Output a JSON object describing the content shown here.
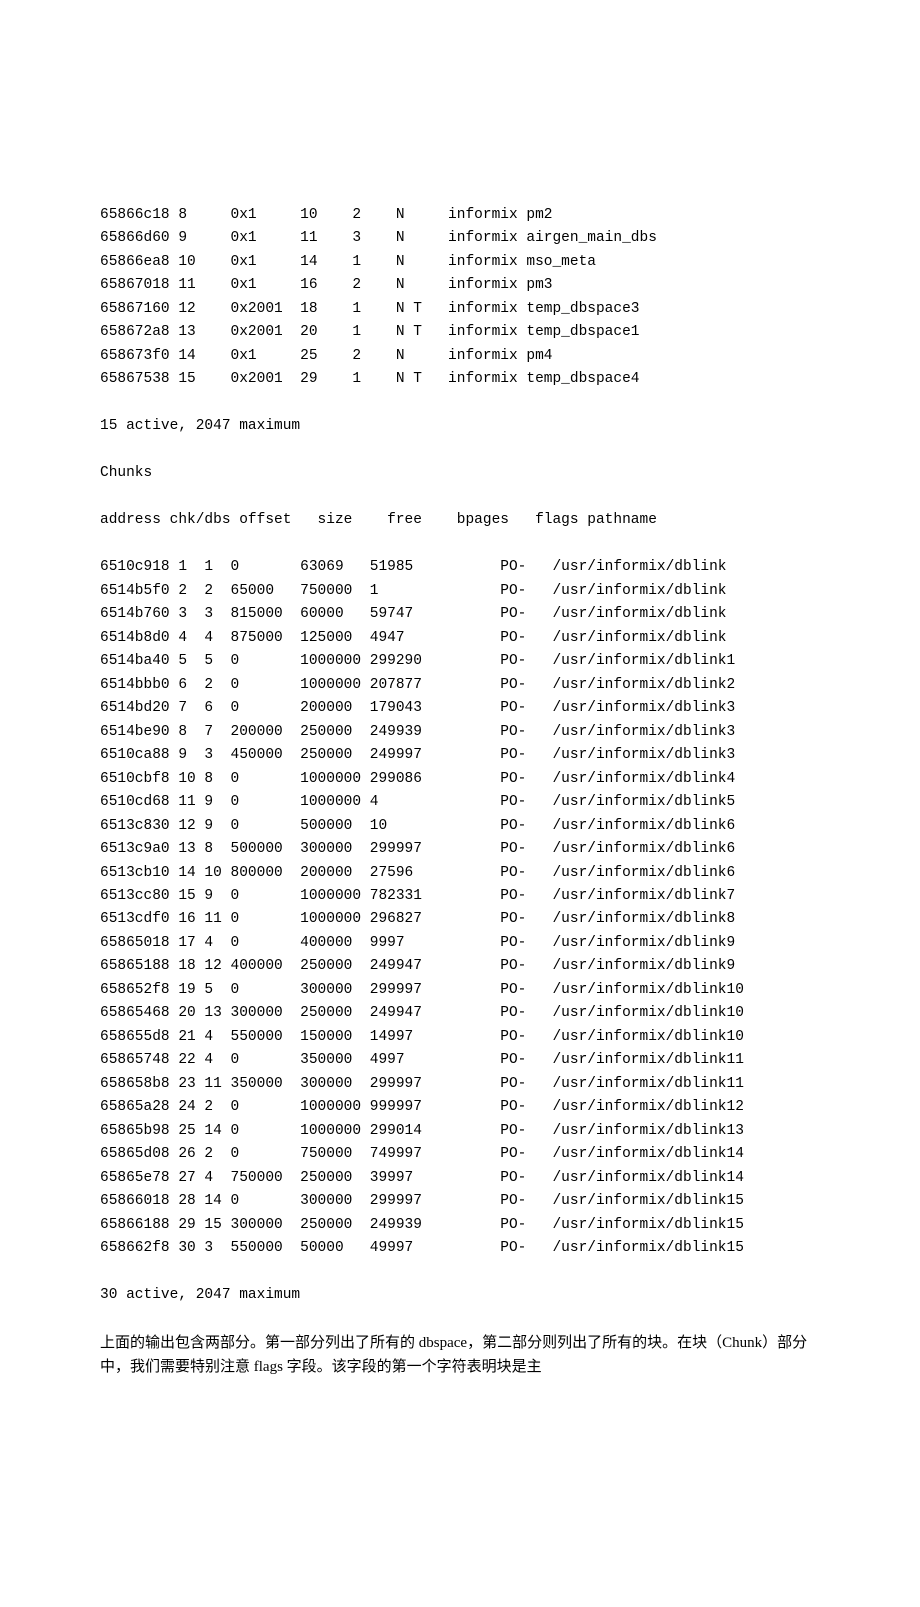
{
  "dbspaces": [
    {
      "address": "65866c18",
      "number": "8",
      "flags": "0x1",
      "fchunk": "10",
      "nchunks": "2",
      "pgsize": "N",
      "owner": "informix",
      "name": "pm2"
    },
    {
      "address": "65866d60",
      "number": "9",
      "flags": "0x1",
      "fchunk": "11",
      "nchunks": "3",
      "pgsize": "N",
      "owner": "informix",
      "name": "airgen_main_dbs"
    },
    {
      "address": "65866ea8",
      "number": "10",
      "flags": "0x1",
      "fchunk": "14",
      "nchunks": "1",
      "pgsize": "N",
      "owner": "informix",
      "name": "mso_meta"
    },
    {
      "address": "65867018",
      "number": "11",
      "flags": "0x1",
      "fchunk": "16",
      "nchunks": "2",
      "pgsize": "N",
      "owner": "informix",
      "name": "pm3"
    },
    {
      "address": "65867160",
      "number": "12",
      "flags": "0x2001",
      "fchunk": "18",
      "nchunks": "1",
      "pgsize": "N T",
      "owner": "informix",
      "name": "temp_dbspace3"
    },
    {
      "address": "658672a8",
      "number": "13",
      "flags": "0x2001",
      "fchunk": "20",
      "nchunks": "1",
      "pgsize": "N T",
      "owner": "informix",
      "name": "temp_dbspace1"
    },
    {
      "address": "658673f0",
      "number": "14",
      "flags": "0x1",
      "fchunk": "25",
      "nchunks": "2",
      "pgsize": "N",
      "owner": "informix",
      "name": "pm4"
    },
    {
      "address": "65867538",
      "number": "15",
      "flags": "0x2001",
      "fchunk": "29",
      "nchunks": "1",
      "pgsize": "N T",
      "owner": "informix",
      "name": "temp_dbspace4"
    }
  ],
  "dbspaces_summary": "15 active, 2047 maximum",
  "chunks_heading": "Chunks",
  "chunks_header": "address chk/dbs offset   size    free    bpages   flags pathname",
  "chunks": [
    {
      "address": "6510c918",
      "chk": "1",
      "dbs": "1",
      "offset": "0",
      "size": "63069",
      "free": "51985",
      "bpages": "",
      "flags": "PO-",
      "pathname": "/usr/informix/dblink"
    },
    {
      "address": "6514b5f0",
      "chk": "2",
      "dbs": "2",
      "offset": "65000",
      "size": "750000",
      "free": "1",
      "bpages": "",
      "flags": "PO-",
      "pathname": "/usr/informix/dblink"
    },
    {
      "address": "6514b760",
      "chk": "3",
      "dbs": "3",
      "offset": "815000",
      "size": "60000",
      "free": "59747",
      "bpages": "",
      "flags": "PO-",
      "pathname": "/usr/informix/dblink"
    },
    {
      "address": "6514b8d0",
      "chk": "4",
      "dbs": "4",
      "offset": "875000",
      "size": "125000",
      "free": "4947",
      "bpages": "",
      "flags": "PO-",
      "pathname": "/usr/informix/dblink"
    },
    {
      "address": "6514ba40",
      "chk": "5",
      "dbs": "5",
      "offset": "0",
      "size": "1000000",
      "free": "299290",
      "bpages": "",
      "flags": "PO-",
      "pathname": "/usr/informix/dblink1"
    },
    {
      "address": "6514bbb0",
      "chk": "6",
      "dbs": "2",
      "offset": "0",
      "size": "1000000",
      "free": "207877",
      "bpages": "",
      "flags": "PO-",
      "pathname": "/usr/informix/dblink2"
    },
    {
      "address": "6514bd20",
      "chk": "7",
      "dbs": "6",
      "offset": "0",
      "size": "200000",
      "free": "179043",
      "bpages": "",
      "flags": "PO-",
      "pathname": "/usr/informix/dblink3"
    },
    {
      "address": "6514be90",
      "chk": "8",
      "dbs": "7",
      "offset": "200000",
      "size": "250000",
      "free": "249939",
      "bpages": "",
      "flags": "PO-",
      "pathname": "/usr/informix/dblink3"
    },
    {
      "address": "6510ca88",
      "chk": "9",
      "dbs": "3",
      "offset": "450000",
      "size": "250000",
      "free": "249997",
      "bpages": "",
      "flags": "PO-",
      "pathname": "/usr/informix/dblink3"
    },
    {
      "address": "6510cbf8",
      "chk": "10",
      "dbs": "8",
      "offset": "0",
      "size": "1000000",
      "free": "299086",
      "bpages": "",
      "flags": "PO-",
      "pathname": "/usr/informix/dblink4"
    },
    {
      "address": "6510cd68",
      "chk": "11",
      "dbs": "9",
      "offset": "0",
      "size": "1000000",
      "free": "4",
      "bpages": "",
      "flags": "PO-",
      "pathname": "/usr/informix/dblink5"
    },
    {
      "address": "6513c830",
      "chk": "12",
      "dbs": "9",
      "offset": "0",
      "size": "500000",
      "free": "10",
      "bpages": "",
      "flags": "PO-",
      "pathname": "/usr/informix/dblink6"
    },
    {
      "address": "6513c9a0",
      "chk": "13",
      "dbs": "8",
      "offset": "500000",
      "size": "300000",
      "free": "299997",
      "bpages": "",
      "flags": "PO-",
      "pathname": "/usr/informix/dblink6"
    },
    {
      "address": "6513cb10",
      "chk": "14",
      "dbs": "10",
      "offset": "800000",
      "size": "200000",
      "free": "27596",
      "bpages": "",
      "flags": "PO-",
      "pathname": "/usr/informix/dblink6"
    },
    {
      "address": "6513cc80",
      "chk": "15",
      "dbs": "9",
      "offset": "0",
      "size": "1000000",
      "free": "782331",
      "bpages": "",
      "flags": "PO-",
      "pathname": "/usr/informix/dblink7"
    },
    {
      "address": "6513cdf0",
      "chk": "16",
      "dbs": "11",
      "offset": "0",
      "size": "1000000",
      "free": "296827",
      "bpages": "",
      "flags": "PO-",
      "pathname": "/usr/informix/dblink8"
    },
    {
      "address": "65865018",
      "chk": "17",
      "dbs": "4",
      "offset": "0",
      "size": "400000",
      "free": "9997",
      "bpages": "",
      "flags": "PO-",
      "pathname": "/usr/informix/dblink9"
    },
    {
      "address": "65865188",
      "chk": "18",
      "dbs": "12",
      "offset": "400000",
      "size": "250000",
      "free": "249947",
      "bpages": "",
      "flags": "PO-",
      "pathname": "/usr/informix/dblink9"
    },
    {
      "address": "658652f8",
      "chk": "19",
      "dbs": "5",
      "offset": "0",
      "size": "300000",
      "free": "299997",
      "bpages": "",
      "flags": "PO-",
      "pathname": "/usr/informix/dblink10"
    },
    {
      "address": "65865468",
      "chk": "20",
      "dbs": "13",
      "offset": "300000",
      "size": "250000",
      "free": "249947",
      "bpages": "",
      "flags": "PO-",
      "pathname": "/usr/informix/dblink10"
    },
    {
      "address": "658655d8",
      "chk": "21",
      "dbs": "4",
      "offset": "550000",
      "size": "150000",
      "free": "14997",
      "bpages": "",
      "flags": "PO-",
      "pathname": "/usr/informix/dblink10"
    },
    {
      "address": "65865748",
      "chk": "22",
      "dbs": "4",
      "offset": "0",
      "size": "350000",
      "free": "4997",
      "bpages": "",
      "flags": "PO-",
      "pathname": "/usr/informix/dblink11"
    },
    {
      "address": "658658b8",
      "chk": "23",
      "dbs": "11",
      "offset": "350000",
      "size": "300000",
      "free": "299997",
      "bpages": "",
      "flags": "PO-",
      "pathname": "/usr/informix/dblink11"
    },
    {
      "address": "65865a28",
      "chk": "24",
      "dbs": "2",
      "offset": "0",
      "size": "1000000",
      "free": "999997",
      "bpages": "",
      "flags": "PO-",
      "pathname": "/usr/informix/dblink12"
    },
    {
      "address": "65865b98",
      "chk": "25",
      "dbs": "14",
      "offset": "0",
      "size": "1000000",
      "free": "299014",
      "bpages": "",
      "flags": "PO-",
      "pathname": "/usr/informix/dblink13"
    },
    {
      "address": "65865d08",
      "chk": "26",
      "dbs": "2",
      "offset": "0",
      "size": "750000",
      "free": "749997",
      "bpages": "",
      "flags": "PO-",
      "pathname": "/usr/informix/dblink14"
    },
    {
      "address": "65865e78",
      "chk": "27",
      "dbs": "4",
      "offset": "750000",
      "size": "250000",
      "free": "39997",
      "bpages": "",
      "flags": "PO-",
      "pathname": "/usr/informix/dblink14"
    },
    {
      "address": "65866018",
      "chk": "28",
      "dbs": "14",
      "offset": "0",
      "size": "300000",
      "free": "299997",
      "bpages": "",
      "flags": "PO-",
      "pathname": "/usr/informix/dblink15"
    },
    {
      "address": "65866188",
      "chk": "29",
      "dbs": "15",
      "offset": "300000",
      "size": "250000",
      "free": "249939",
      "bpages": "",
      "flags": "PO-",
      "pathname": "/usr/informix/dblink15"
    },
    {
      "address": "658662f8",
      "chk": "30",
      "dbs": "3",
      "offset": "550000",
      "size": "50000",
      "free": "49997",
      "bpages": "",
      "flags": "PO-",
      "pathname": "/usr/informix/dblink15"
    }
  ],
  "chunks_summary": "30 active, 2047 maximum",
  "paragraph1": "上面的输出包含两部分。第一部分列出了所有的 dbspace，第二部分则列出了所有的块。在块（Chunk）部分中，我们需要特别注意 flags 字段。该字段的第一个字符表明块是主"
}
